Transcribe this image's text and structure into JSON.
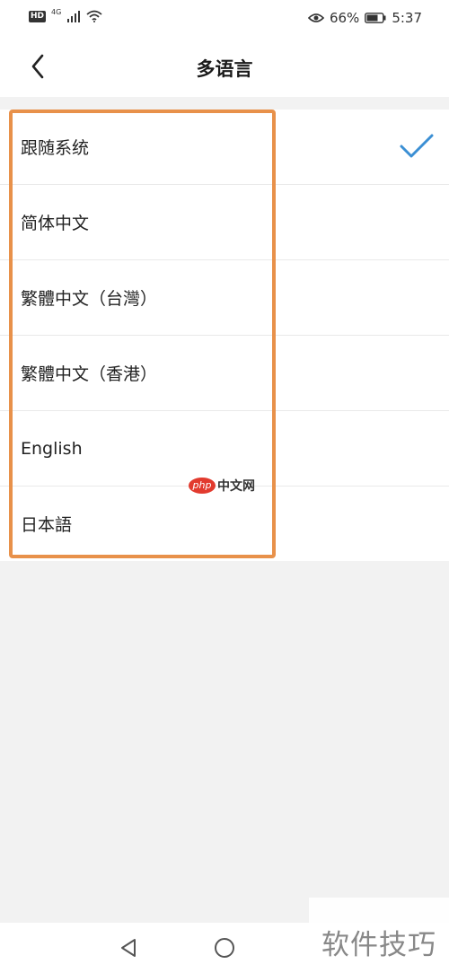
{
  "status_bar": {
    "hd": "HD",
    "network": "4G",
    "battery_percent": "66%",
    "time": "5:37"
  },
  "header": {
    "title": "多语言"
  },
  "languages": [
    {
      "label": "跟随系统",
      "selected": true
    },
    {
      "label": "简体中文",
      "selected": false
    },
    {
      "label": "繁體中文（台灣）",
      "selected": false
    },
    {
      "label": "繁體中文（香港）",
      "selected": false
    },
    {
      "label": "English",
      "selected": false
    },
    {
      "label": "日本語",
      "selected": false
    }
  ],
  "watermarks": {
    "php_logo": "php",
    "php_text": "中文网",
    "corner_text": "软件技巧"
  },
  "colors": {
    "accent": "#3b8fd4",
    "highlight": "#e8914a"
  }
}
